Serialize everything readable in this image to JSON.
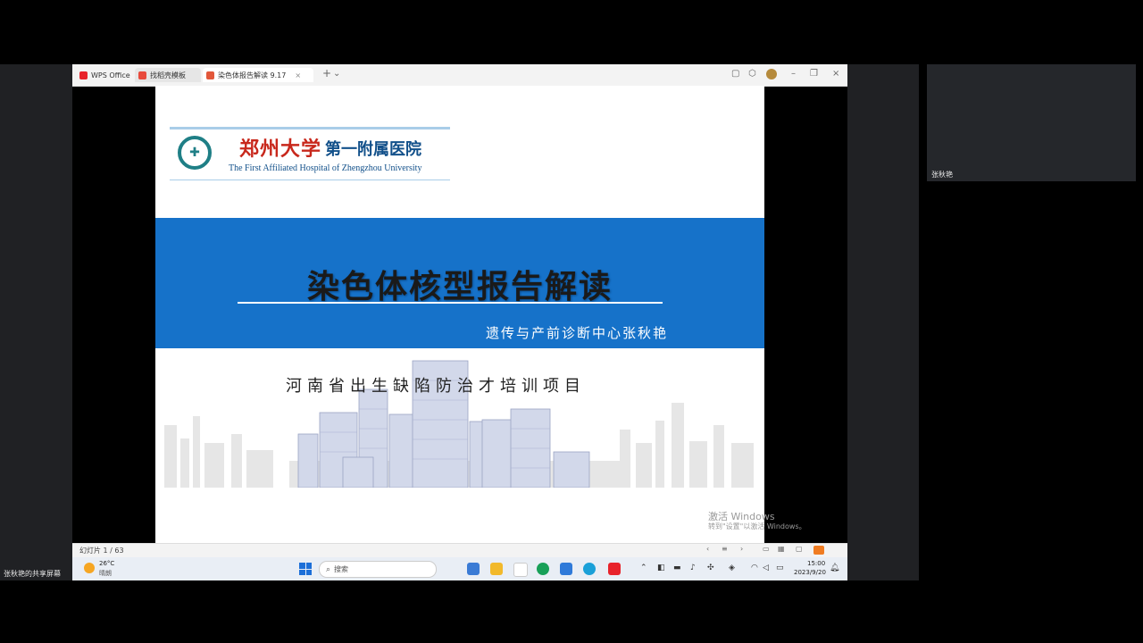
{
  "meeting": {
    "participant_name": "张秋艳",
    "sharing_label": "张秋艳的共享屏幕"
  },
  "wps": {
    "tabs": [
      {
        "label": "WPS Office"
      },
      {
        "label": "找稻壳模板"
      },
      {
        "label": "染色体报告解读 9.17"
      }
    ],
    "slide_counter": "幻灯片 1 / 63"
  },
  "slide": {
    "logo_cn_university": "郑州大学",
    "logo_cn_hospital": "第一附属医院",
    "logo_en": "The First Affiliated Hospital of Zhengzhou University",
    "title": "染色体核型报告解读",
    "author": "遗传与产前诊断中心张秋艳",
    "project": "河南省出生缺陷防治才培训项目",
    "band_color": "#1672c9"
  },
  "watermark": {
    "line1": "激活 Windows",
    "line2": "转到\"设置\"以激活 Windows。"
  },
  "taskbar": {
    "weather_temp": "26°C",
    "weather_desc": "晴朗",
    "search_placeholder": "搜索",
    "time": "15:00",
    "date": "2023/9/20"
  }
}
